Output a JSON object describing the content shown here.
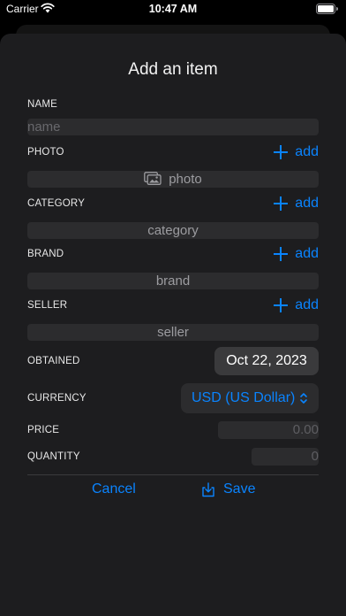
{
  "status": {
    "carrier": "Carrier",
    "time": "10:47 AM"
  },
  "title": "Add an item",
  "fields": {
    "name": {
      "label": "NAME",
      "placeholder": "name"
    },
    "photo": {
      "label": "PHOTO",
      "add_label": "add",
      "value": "photo",
      "icon": "photo-stack-icon"
    },
    "category": {
      "label": "CATEGORY",
      "add_label": "add",
      "value": "category"
    },
    "brand": {
      "label": "BRAND",
      "add_label": "add",
      "value": "brand"
    },
    "seller": {
      "label": "SELLER",
      "add_label": "add",
      "value": "seller"
    },
    "obtained": {
      "label": "OBTAINED",
      "value": "Oct 22, 2023"
    },
    "currency": {
      "label": "CURRENCY",
      "value": "USD (US Dollar)"
    },
    "price": {
      "label": "PRICE",
      "placeholder": "0.00"
    },
    "quantity": {
      "label": "QUANTITY",
      "placeholder": "0"
    }
  },
  "actions": {
    "cancel": "Cancel",
    "save": "Save"
  },
  "colors": {
    "accent": "#0a84ff",
    "sheet": "#1d1d1f",
    "field": "#2c2c2e"
  }
}
